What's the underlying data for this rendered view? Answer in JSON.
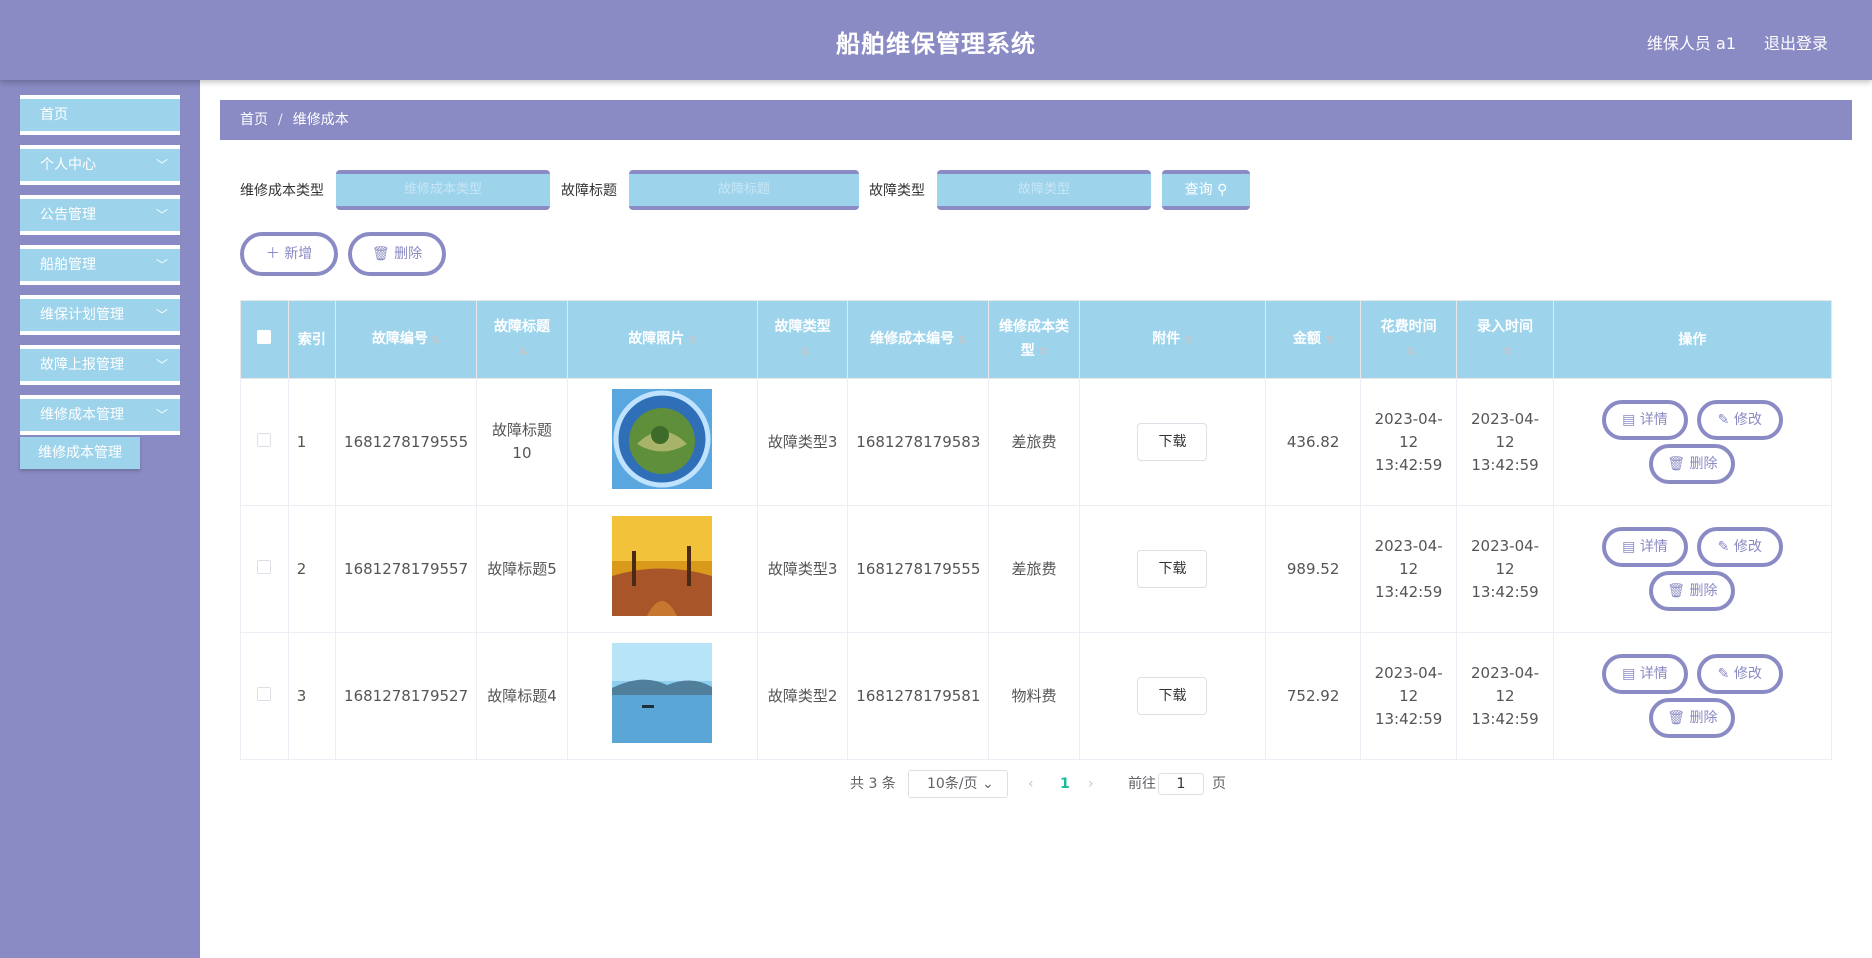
{
  "header": {
    "title": "船舶维保管理系统",
    "user": "维保人员 a1",
    "logout": "退出登录"
  },
  "sidebar": {
    "items": [
      {
        "label": "首页",
        "chevron": false
      },
      {
        "label": "个人中心",
        "chevron": true
      },
      {
        "label": "公告管理",
        "chevron": true
      },
      {
        "label": "船舶管理",
        "chevron": true
      },
      {
        "label": "维保计划管理",
        "chevron": true
      },
      {
        "label": "故障上报管理",
        "chevron": true
      },
      {
        "label": "维修成本管理",
        "chevron": true
      }
    ],
    "submenu": {
      "label": "维修成本管理"
    }
  },
  "breadcrumb": {
    "home": "首页",
    "sep": "/",
    "current": "维修成本"
  },
  "search": {
    "field1_label": "维修成本类型",
    "field1_placeholder": "维修成本类型",
    "field2_label": "故障标题",
    "field2_placeholder": "故障标题",
    "field3_label": "故障类型",
    "field3_placeholder": "故障类型",
    "query_label": "查询"
  },
  "actions": {
    "add_label": "新增",
    "delete_label": "删除"
  },
  "table": {
    "headers": {
      "index": "索引",
      "fault_no": "故障编号",
      "fault_title": "故障标题",
      "fault_photo": "故障照片",
      "fault_type": "故障类型",
      "cost_no": "维修成本编号",
      "cost_type": "维修成本类型",
      "attachment": "附件",
      "amount": "金额",
      "spend_time": "花费时间",
      "entry_time": "录入时间",
      "ops": "操作"
    },
    "rows": [
      {
        "index": "1",
        "fault_no": "1681278179555",
        "fault_title": "故障标题10",
        "fault_type": "故障类型3",
        "cost_no": "1681278179583",
        "cost_type": "差旅费",
        "attachment": "下载",
        "amount": "436.82",
        "spend_time": "2023-04-12 13:42:59",
        "entry_time": "2023-04-12 13:42:59"
      },
      {
        "index": "2",
        "fault_no": "1681278179557",
        "fault_title": "故障标题5",
        "fault_type": "故障类型3",
        "cost_no": "1681278179555",
        "cost_type": "差旅费",
        "attachment": "下载",
        "amount": "989.52",
        "spend_time": "2023-04-12 13:42:59",
        "entry_time": "2023-04-12 13:42:59"
      },
      {
        "index": "3",
        "fault_no": "1681278179527",
        "fault_title": "故障标题4",
        "fault_type": "故障类型2",
        "cost_no": "1681278179581",
        "cost_type": "物料费",
        "attachment": "下载",
        "amount": "752.92",
        "spend_time": "2023-04-12 13:42:59",
        "entry_time": "2023-04-12 13:42:59"
      }
    ],
    "row_actions": {
      "detail": "详情",
      "edit": "修改",
      "delete": "删除"
    }
  },
  "pagination": {
    "total": "共 3 条",
    "page_size": "10条/页",
    "current_page": "1",
    "goto_label": "前往",
    "goto_value": "1",
    "page_suffix": "页"
  },
  "colors": {
    "primary": "#8a8ac4",
    "accent": "#9dd4ec",
    "active_page": "#1abc9c"
  }
}
